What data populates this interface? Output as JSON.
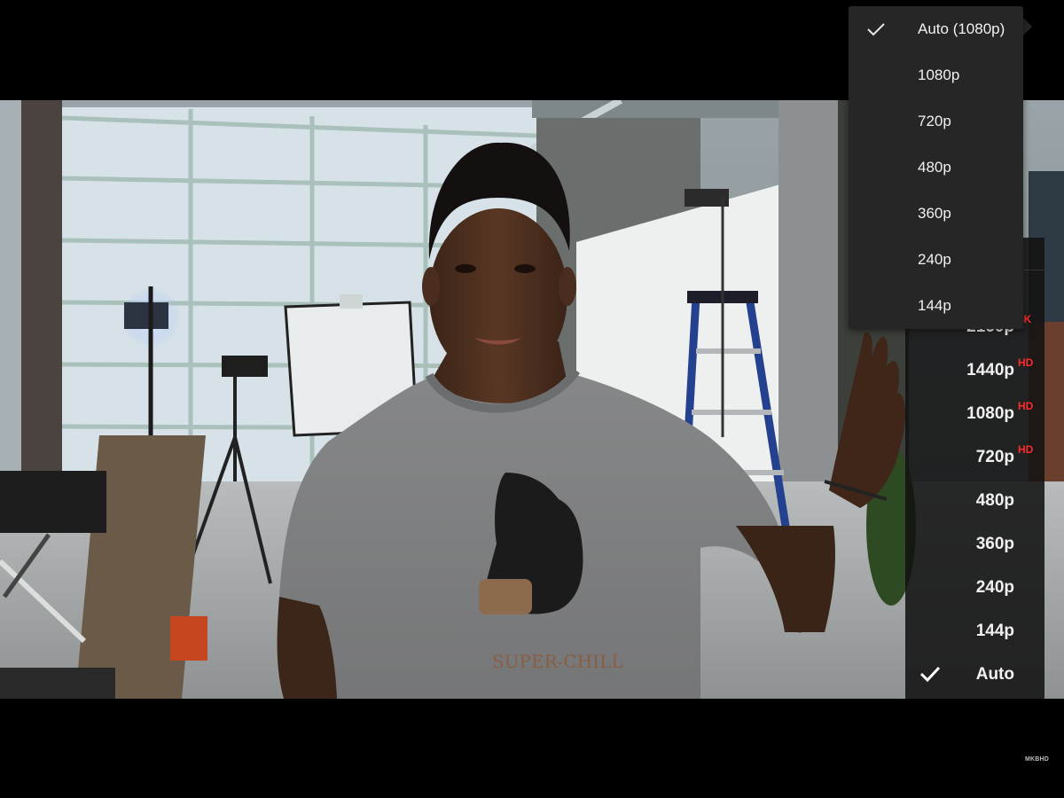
{
  "video": {
    "frame_description_icon": "video-frame",
    "shirt_text": "SUPER-CHILL"
  },
  "watermark": "MKBHD",
  "quality_menu_front": {
    "items": [
      {
        "label": "Auto (1080p)",
        "selected": true
      },
      {
        "label": "1080p",
        "selected": false
      },
      {
        "label": "720p",
        "selected": false
      },
      {
        "label": "480p",
        "selected": false
      },
      {
        "label": "360p",
        "selected": false
      },
      {
        "label": "240p",
        "selected": false
      },
      {
        "label": "144p",
        "selected": false
      }
    ],
    "check_icon": "check-icon",
    "background_color": "#262626"
  },
  "quality_menu_back": {
    "items": [
      {
        "label": "2160p",
        "badge": "4K",
        "selected": false
      },
      {
        "label": "1440p",
        "badge": "HD",
        "selected": false
      },
      {
        "label": "1080p",
        "badge": "HD",
        "selected": false
      },
      {
        "label": "720p",
        "badge": "HD",
        "selected": false
      },
      {
        "label": "480p",
        "badge": "",
        "selected": false
      },
      {
        "label": "360p",
        "badge": "",
        "selected": false
      },
      {
        "label": "240p",
        "badge": "",
        "selected": false
      },
      {
        "label": "144p",
        "badge": "",
        "selected": false
      },
      {
        "label": "Auto",
        "badge": "",
        "selected": true
      }
    ],
    "badge_color": "#ff2a2a"
  }
}
